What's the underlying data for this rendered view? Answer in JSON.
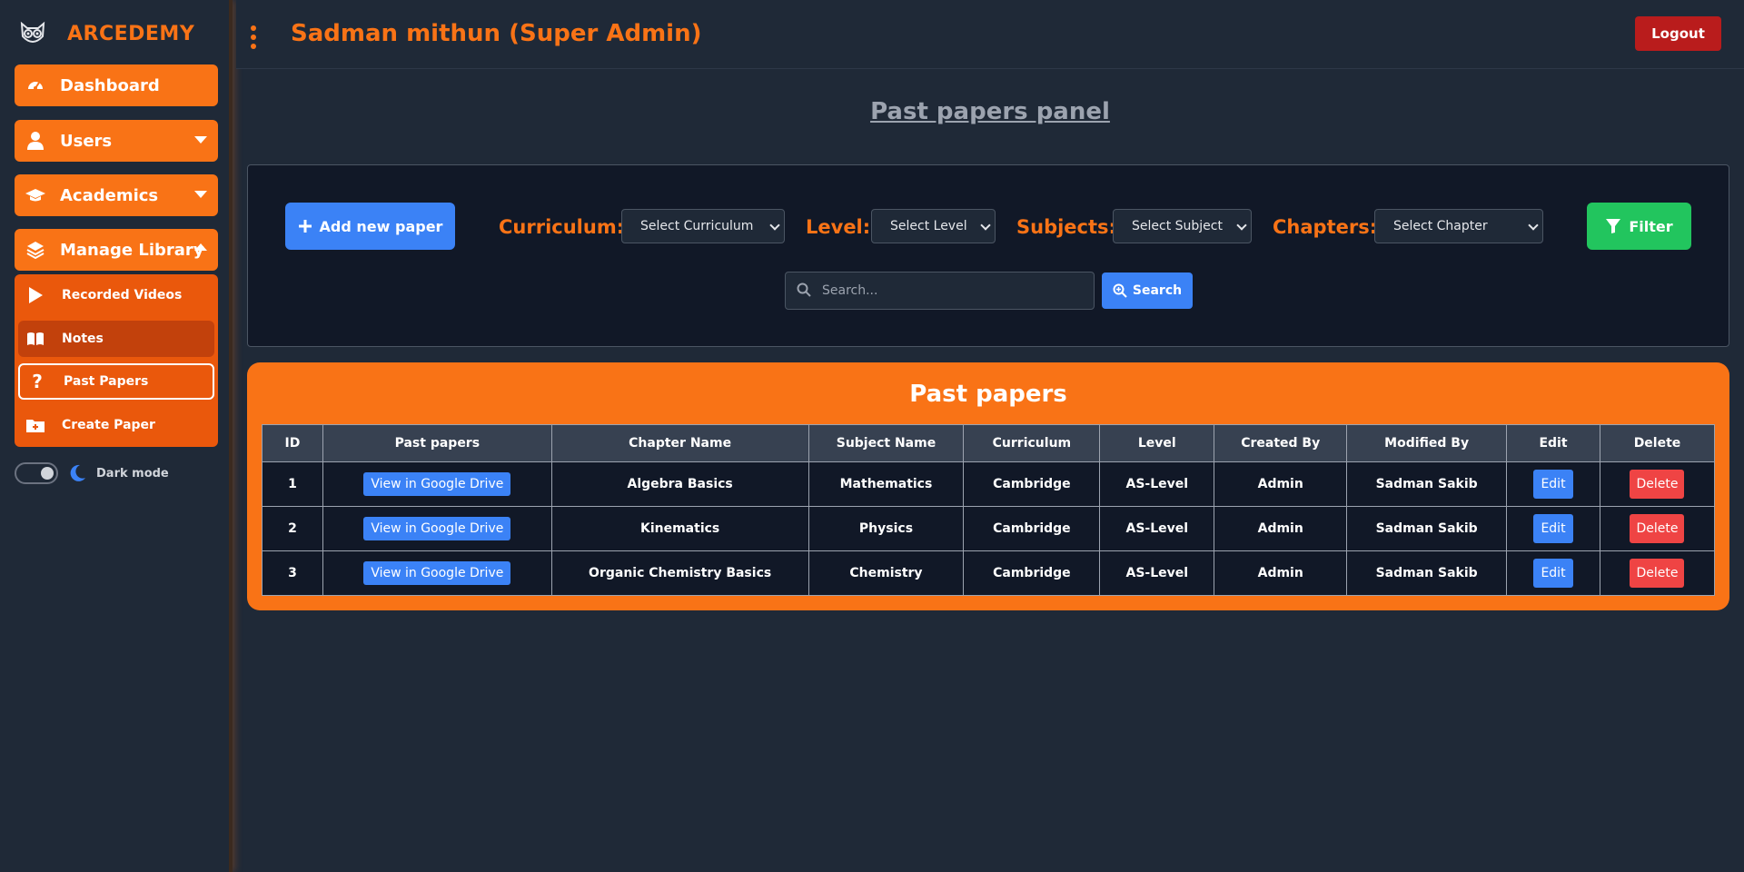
{
  "brand": {
    "name": "ARCEDEMY"
  },
  "header": {
    "title": "Sadman mithun (Super Admin)",
    "logout_label": "Logout"
  },
  "sidebar": {
    "items": [
      {
        "label": "Dashboard",
        "icon": "gauge-icon"
      },
      {
        "label": "Users",
        "icon": "user-icon"
      },
      {
        "label": "Academics",
        "icon": "graduation-cap-icon"
      },
      {
        "label": "Manage Library",
        "icon": "layers-icon"
      }
    ],
    "submenu": [
      {
        "label": "Recorded Videos",
        "icon": "play-icon"
      },
      {
        "label": "Notes",
        "icon": "book-open-icon"
      },
      {
        "label": "Past Papers",
        "icon": "question-icon"
      },
      {
        "label": "Create Paper",
        "icon": "folder-plus-icon"
      }
    ],
    "dark_mode_label": "Dark mode"
  },
  "page": {
    "panel_title": "Past papers panel"
  },
  "filters": {
    "add_label": "Add new paper",
    "curriculum_label": "Curriculum:",
    "curriculum_value": "Select Curriculum",
    "level_label": "Level:",
    "level_value": "Select Level",
    "subjects_label": "Subjects:",
    "subjects_value": "Select Subject",
    "chapters_label": "Chapters:",
    "chapters_value": "Select Chapter",
    "filter_label": "Filter",
    "search_placeholder": "Search...",
    "search_label": "Search"
  },
  "table": {
    "title": "Past papers",
    "headers": [
      "ID",
      "Past papers",
      "Chapter Name",
      "Subject Name",
      "Curriculum",
      "Level",
      "Created By",
      "Modified By",
      "Edit",
      "Delete"
    ],
    "rows": [
      {
        "id": "1",
        "link": "View in Google Drive",
        "chapter": "Algebra Basics",
        "subject": "Mathematics",
        "curriculum": "Cambridge",
        "level": "AS-Level",
        "created": "Admin",
        "modified": "Sadman Sakib",
        "edit": "Edit",
        "delete": "Delete"
      },
      {
        "id": "2",
        "link": "View in Google Drive",
        "chapter": "Kinematics",
        "subject": "Physics",
        "curriculum": "Cambridge",
        "level": "AS-Level",
        "created": "Admin",
        "modified": "Sadman Sakib",
        "edit": "Edit",
        "delete": "Delete"
      },
      {
        "id": "3",
        "link": "View in Google Drive",
        "chapter": "Organic Chemistry Basics",
        "subject": "Chemistry",
        "curriculum": "Cambridge",
        "level": "AS-Level",
        "created": "Admin",
        "modified": "Sadman Sakib",
        "edit": "Edit",
        "delete": "Delete"
      }
    ]
  },
  "colors": {
    "accent": "#f97316",
    "primary": "#3b82f6",
    "success": "#22c55e",
    "danger": "#ef4444",
    "logout": "#b91c1c"
  }
}
